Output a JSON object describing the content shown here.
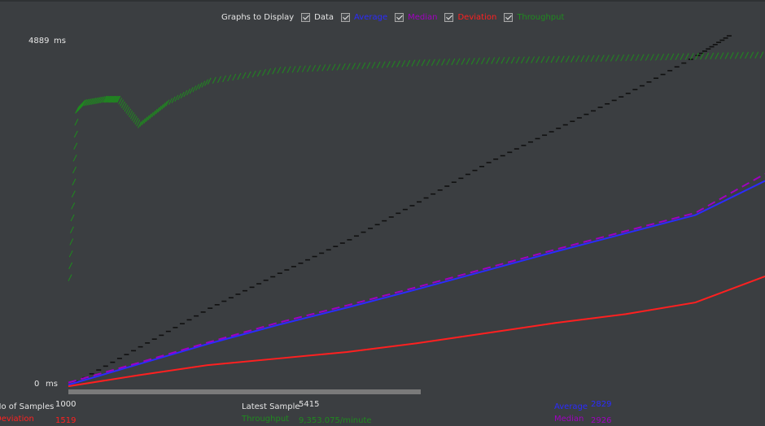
{
  "legend": {
    "title": "Graphs to Display",
    "options": [
      {
        "label": "Data",
        "color": "#e6e6e6",
        "checked": true
      },
      {
        "label": "Average",
        "color": "#2b2bff",
        "checked": true
      },
      {
        "label": "Median",
        "color": "#a000c0",
        "checked": true
      },
      {
        "label": "Deviation",
        "color": "#ff2020",
        "checked": true
      },
      {
        "label": "Throughput",
        "color": "#1f8a1f",
        "checked": true
      }
    ]
  },
  "axis": {
    "y_max_label": "4889",
    "y_min_label": "0",
    "unit": "ms"
  },
  "stats": {
    "samples_label": "No of Samples",
    "samples_value": "1000",
    "deviation_label": "Deviation",
    "deviation_value": "1519",
    "latest_label": "Latest Sample",
    "latest_value": "5415",
    "throughput_label": "Throughput",
    "throughput_value": "9,353.075/minute",
    "average_label": "Average",
    "average_value": "2829",
    "median_label": "Median",
    "median_value": "2926"
  },
  "chart_data": {
    "type": "line",
    "ylim": [
      0,
      4889
    ],
    "ylabel": "ms",
    "samples": 1000,
    "series": [
      {
        "name": "Data",
        "color": "#101010",
        "x": [
          0,
          100,
          200,
          300,
          400,
          500,
          600,
          700,
          800,
          900,
          950
        ],
        "values": [
          30,
          560,
          1090,
          1570,
          2030,
          2550,
          3090,
          3560,
          4040,
          4560,
          4860
        ]
      },
      {
        "name": "Average",
        "color": "#2b2bff",
        "x": [
          0,
          100,
          200,
          300,
          400,
          500,
          600,
          700,
          800,
          900,
          1000
        ],
        "values": [
          30,
          310,
          590,
          850,
          1090,
          1340,
          1600,
          1860,
          2110,
          2360,
          2829
        ]
      },
      {
        "name": "Median",
        "color": "#a000c0",
        "x": [
          0,
          100,
          200,
          300,
          400,
          500,
          600,
          700,
          800,
          900,
          1000
        ],
        "values": [
          60,
          330,
          610,
          880,
          1120,
          1370,
          1630,
          1890,
          2140,
          2390,
          2926
        ]
      },
      {
        "name": "Deviation",
        "color": "#ff2020",
        "x": [
          0,
          100,
          200,
          300,
          400,
          500,
          600,
          700,
          800,
          900,
          1000
        ],
        "values": [
          10,
          160,
          300,
          390,
          480,
          600,
          740,
          880,
          1000,
          1160,
          1519
        ]
      },
      {
        "name": "Throughput",
        "color": "#1f8a1f",
        "x": [
          0,
          10,
          20,
          50,
          70,
          100,
          140,
          200,
          300,
          400,
          500,
          600,
          700,
          800,
          900,
          1000
        ],
        "values": [
          1500,
          3800,
          3900,
          3950,
          3950,
          3600,
          3900,
          4200,
          4350,
          4400,
          4450,
          4480,
          4500,
          4520,
          4540,
          4560
        ]
      }
    ]
  }
}
